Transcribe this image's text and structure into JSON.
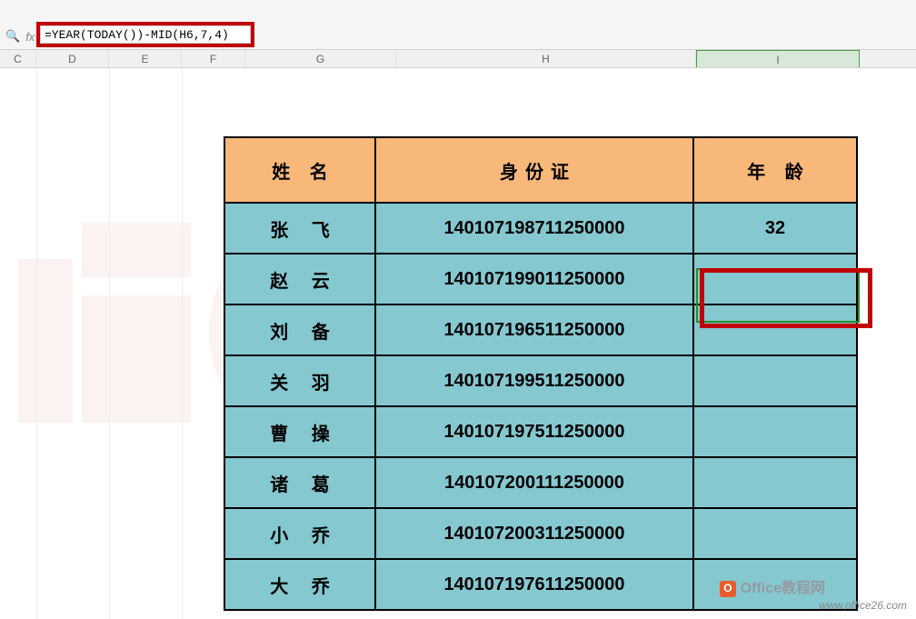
{
  "formula": "=YEAR(TODAY())-MID(H6,7,4)",
  "columns": {
    "C": "C",
    "D": "D",
    "E": "E",
    "F": "F",
    "G": "G",
    "H": "H",
    "I": "I"
  },
  "table": {
    "headers": {
      "name": "姓 名",
      "id": "身份证",
      "age": "年 龄"
    },
    "rows": [
      {
        "name": "张 飞",
        "id": "140107198711250000",
        "age": "32"
      },
      {
        "name": "赵 云",
        "id": "140107199011250000",
        "age": ""
      },
      {
        "name": "刘 备",
        "id": "140107196511250000",
        "age": ""
      },
      {
        "name": "关 羽",
        "id": "140107199511250000",
        "age": ""
      },
      {
        "name": "曹 操",
        "id": "140107197511250000",
        "age": ""
      },
      {
        "name": "诸 葛",
        "id": "140107200111250000",
        "age": ""
      },
      {
        "name": "小 乔",
        "id": "140107200311250000",
        "age": ""
      },
      {
        "name": "大 乔",
        "id": "140107197611250000",
        "age": ""
      }
    ]
  },
  "watermark": {
    "brand": "Office教程网",
    "url": "www.office26.com"
  }
}
